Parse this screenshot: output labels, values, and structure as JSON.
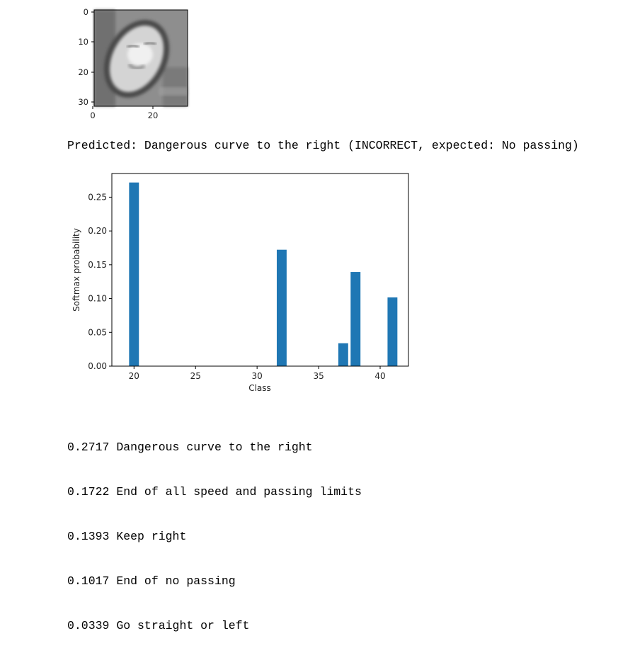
{
  "image_plot": {
    "y_ticks": [
      "0",
      "10",
      "20",
      "30"
    ],
    "x_ticks": [
      "0",
      "20"
    ]
  },
  "prediction_text": "Predicted: Dangerous curve to the right (INCORRECT, expected: No passing)",
  "chart_data": {
    "type": "bar",
    "x": [
      20,
      32,
      37,
      38,
      41
    ],
    "values": [
      0.2717,
      0.1722,
      0.0339,
      0.1393,
      0.1017
    ],
    "xlabel": "Class",
    "ylabel": "Softmax probability",
    "xlim": [
      18.2,
      42.3
    ],
    "ylim": [
      0,
      0.285
    ],
    "x_ticks": [
      20,
      25,
      30,
      35,
      40
    ],
    "y_ticks": [
      0.0,
      0.05,
      0.1,
      0.15,
      0.2,
      0.25
    ],
    "y_tick_labels": [
      "0.00",
      "0.05",
      "0.10",
      "0.15",
      "0.20",
      "0.25"
    ],
    "bar_color": "#1f77b4",
    "grid": false
  },
  "results": [
    {
      "prob": "0.2717",
      "label": "Dangerous curve to the right"
    },
    {
      "prob": "0.1722",
      "label": "End of all speed and passing limits"
    },
    {
      "prob": "0.1393",
      "label": "Keep right"
    },
    {
      "prob": "0.1017",
      "label": "End of no passing"
    },
    {
      "prob": "0.0339",
      "label": "Go straight or left"
    }
  ]
}
